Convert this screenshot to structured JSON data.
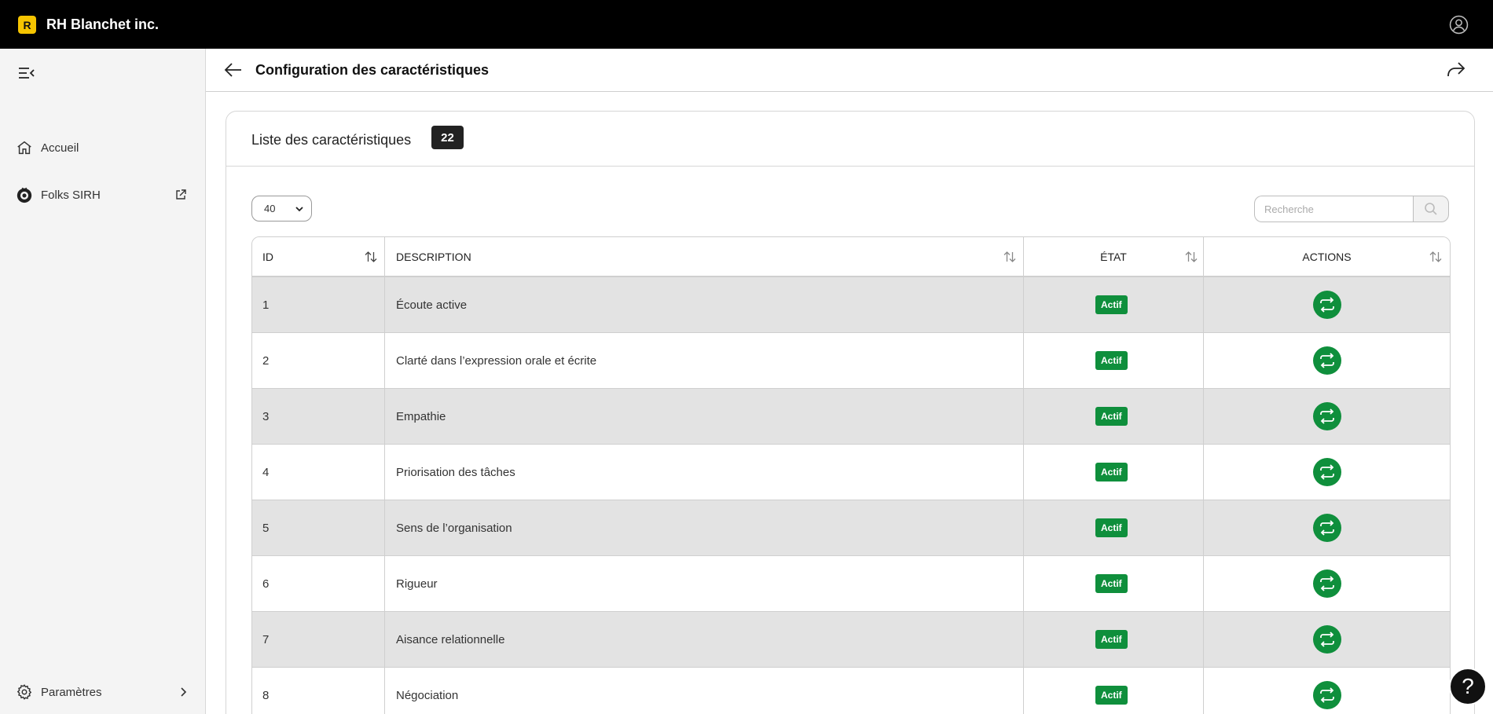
{
  "app": {
    "logo_letter": "R",
    "company_name": "RH Blanchet inc."
  },
  "sidebar": {
    "items": [
      {
        "label": "Accueil",
        "icon": "home-icon"
      },
      {
        "label": "Folks SIRH",
        "icon": "folks-logo-icon",
        "external": true
      },
      {
        "label": "Paramètres",
        "icon": "gear-icon"
      }
    ]
  },
  "header": {
    "title": "Configuration des caractéristiques"
  },
  "card": {
    "title": "Liste des caractéristiques",
    "count": "22"
  },
  "controls": {
    "page_size": "40",
    "search_placeholder": "Recherche"
  },
  "table": {
    "columns": [
      "ID",
      "DESCRIPTION",
      "ÉTAT",
      "ACTIONS"
    ],
    "rows": [
      {
        "id": "1",
        "description": "Écoute active",
        "status": "Actif"
      },
      {
        "id": "2",
        "description": "Clarté dans l’expression orale et écrite",
        "status": "Actif"
      },
      {
        "id": "3",
        "description": "Empathie",
        "status": "Actif"
      },
      {
        "id": "4",
        "description": "Priorisation des tâches",
        "status": "Actif"
      },
      {
        "id": "5",
        "description": "Sens de l’organisation",
        "status": "Actif"
      },
      {
        "id": "6",
        "description": "Rigueur",
        "status": "Actif"
      },
      {
        "id": "7",
        "description": "Aisance relationnelle",
        "status": "Actif"
      },
      {
        "id": "8",
        "description": "Négociation",
        "status": "Actif"
      }
    ]
  },
  "help": {
    "label": "?"
  },
  "colors": {
    "topbar": "#000000",
    "logo": "#f5c400",
    "status_green": "#0f8f3c",
    "row_alt": "#e3e3e3",
    "sidebar_bg": "#f4f4f4"
  }
}
